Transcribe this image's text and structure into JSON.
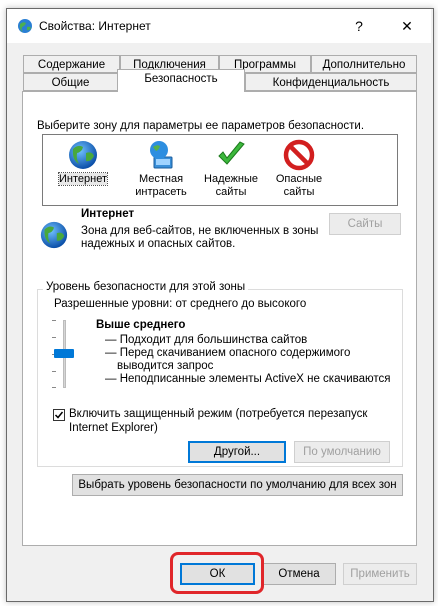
{
  "window": {
    "title": "Свойства: Интернет",
    "help_glyph": "?",
    "close_glyph": "✕"
  },
  "tabs_row1": [
    "Содержание",
    "Подключения",
    "Программы",
    "Дополнительно"
  ],
  "tabs_row2": [
    "Общие",
    "Безопасность",
    "Конфиденциальность"
  ],
  "active_tab": "Безопасность",
  "zone_prompt": "Выберите зону для параметры ее параметров безопасности.",
  "zones": [
    {
      "line1": "Интернет",
      "line2": "",
      "icon": "globe-icon"
    },
    {
      "line1": "Местная",
      "line2": "интрасеть",
      "icon": "intranet-icon"
    },
    {
      "line1": "Надежные",
      "line2": "сайты",
      "icon": "checkmark-icon"
    },
    {
      "line1": "Опасные",
      "line2": "сайты",
      "icon": "forbidden-icon"
    }
  ],
  "selected_zone": {
    "name": "Интернет",
    "desc_line1": "Зона для веб-сайтов, не включенных в зоны",
    "desc_line2": "надежных и опасных сайтов.",
    "sites_button": "Сайты"
  },
  "security_level": {
    "group_title": "Уровень безопасности для этой зоны",
    "allowed": "Разрешенные уровни: от среднего до высокого",
    "level_name": "Выше среднего",
    "level_percent": 50,
    "bullets": [
      "— Подходит для большинства сайтов",
      "— Перед скачиванием опасного содержимого",
      "выводится запрос",
      "— Неподписанные элементы ActiveX не скачиваются"
    ],
    "protected_mode_label_1": "Включить защищенный режим (потребуется перезапуск",
    "protected_mode_label_2": "Internet Explorer)",
    "protected_mode_checked": true,
    "custom_button": "Другой...",
    "default_button": "По умолчанию"
  },
  "reset_all_button": "Выбрать уровень безопасности по умолчанию для всех зон",
  "footer": {
    "ok": "ОК",
    "cancel": "Отмена",
    "apply": "Применить"
  },
  "colors": {
    "accent": "#0078d7",
    "highlight": "#e0262a"
  }
}
